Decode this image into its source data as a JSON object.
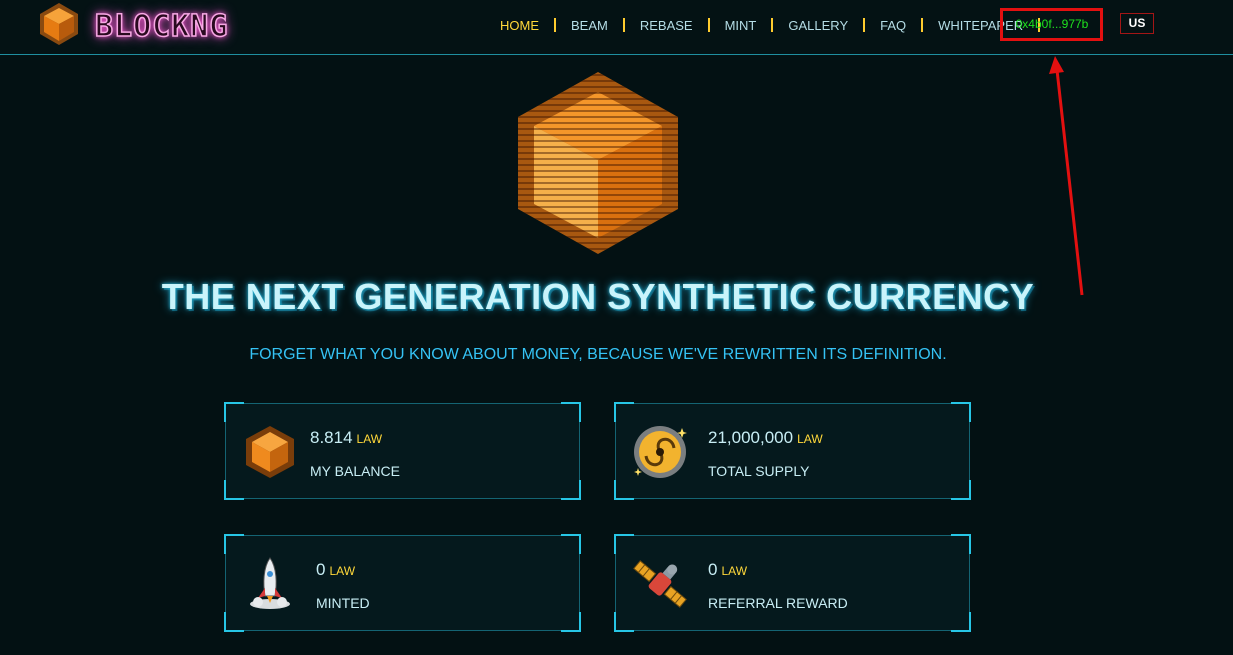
{
  "header": {
    "logo_text": "BLOCKNG",
    "nav": [
      {
        "label": "HOME",
        "active": true
      },
      {
        "label": "BEAM"
      },
      {
        "label": "REBASE"
      },
      {
        "label": "MINT"
      },
      {
        "label": "GALLERY"
      },
      {
        "label": "FAQ"
      },
      {
        "label": "WHITEPAPER"
      }
    ],
    "wallet_address": "0x4b0f...977b",
    "language": "US"
  },
  "hero": {
    "title": "THE NEXT GENERATION SYNTHETIC CURRENCY",
    "subtitle": "FORGET WHAT YOU KNOW ABOUT MONEY, BECAUSE WE'VE REWRITTEN ITS DEFINITION."
  },
  "stats": [
    {
      "value": "8.814",
      "unit": "LAW",
      "label": "MY BALANCE",
      "icon": "cube-icon"
    },
    {
      "value": "21,000,000",
      "unit": "LAW",
      "label": "TOTAL SUPPLY",
      "icon": "galaxy-icon"
    },
    {
      "value": "0",
      "unit": "LAW",
      "label": "MINTED",
      "icon": "rocket-icon"
    },
    {
      "value": "0",
      "unit": "LAW",
      "label": "REFERRAL REWARD",
      "icon": "satellite-icon"
    }
  ],
  "colors": {
    "background": "#031113",
    "accent_cyan": "#27c6e6",
    "active_nav": "#ffd83a",
    "wallet_text": "#1ee31e",
    "highlight_red": "#e31010",
    "logo_glow": "#ff59d8",
    "cube_orange": "#f08a1c"
  }
}
